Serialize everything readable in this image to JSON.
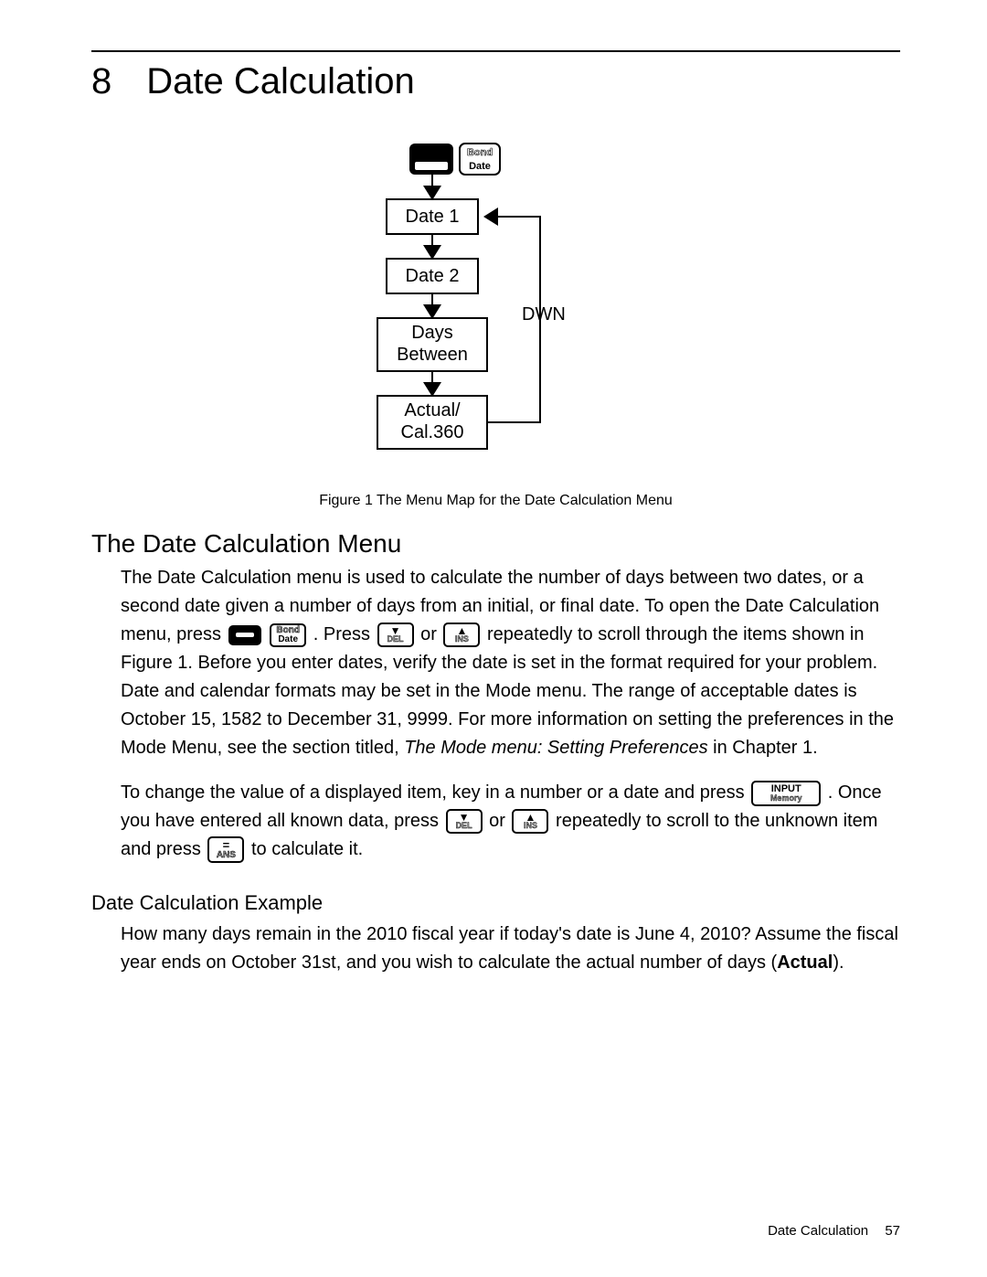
{
  "chapter": {
    "number": "8",
    "title": "Date Calculation"
  },
  "figure": {
    "caption": "Figure 1  The Menu Map for the Date Calculation Menu",
    "key_top": "Bond",
    "key_bot": "Date",
    "nodes": [
      "Date 1",
      "Date 2",
      "Days Between",
      "Actual/ Cal.360"
    ],
    "loop_label": "DWN"
  },
  "section1": {
    "heading": "The Date Calculation Menu",
    "p1a": "The Date Calculation menu is used to calculate the number of days between two dates, or a second date given a number of days from an initial, or final date. To open the Date Calculation menu, press ",
    "p1b": ". Press ",
    "p1c": " or ",
    "p1d": " repeatedly to scroll through the items shown in Figure 1. Before you enter dates, verify the date is set in the format required for your problem. Date and calendar formats may be set in the Mode menu. The range of acceptable dates is October 15, 1582 to December 31, 9999. For more information on setting the preferences in the Mode Menu, see the section titled, ",
    "p1_em": "The Mode menu: Setting Preferences",
    "p1e": " in Chapter 1.",
    "p2a": "To change the value of a displayed item, key in a number or a date and press ",
    "p2b": ". Once you have entered all known data, press ",
    "p2c": " or ",
    "p2d": " repeatedly to scroll to the unknown item and press ",
    "p2e": " to calculate it."
  },
  "section2": {
    "heading": "Date Calculation Example",
    "p1a": "How many days remain in the 2010 fiscal year if today's date is June 4, 2010? Assume the fiscal year ends on October 31st, and you wish to calculate the actual number of days (",
    "p1_bold": "Actual",
    "p1b": ")."
  },
  "keys": {
    "bond_top": "Bond",
    "bond_bot": "Date",
    "down_sub": "DEL",
    "up_sub": "INS",
    "input_top": "INPUT",
    "input_bot": "Memory",
    "eq_top": "=",
    "eq_bot": "ANS"
  },
  "footer": {
    "label": "Date Calculation",
    "page": "57"
  }
}
